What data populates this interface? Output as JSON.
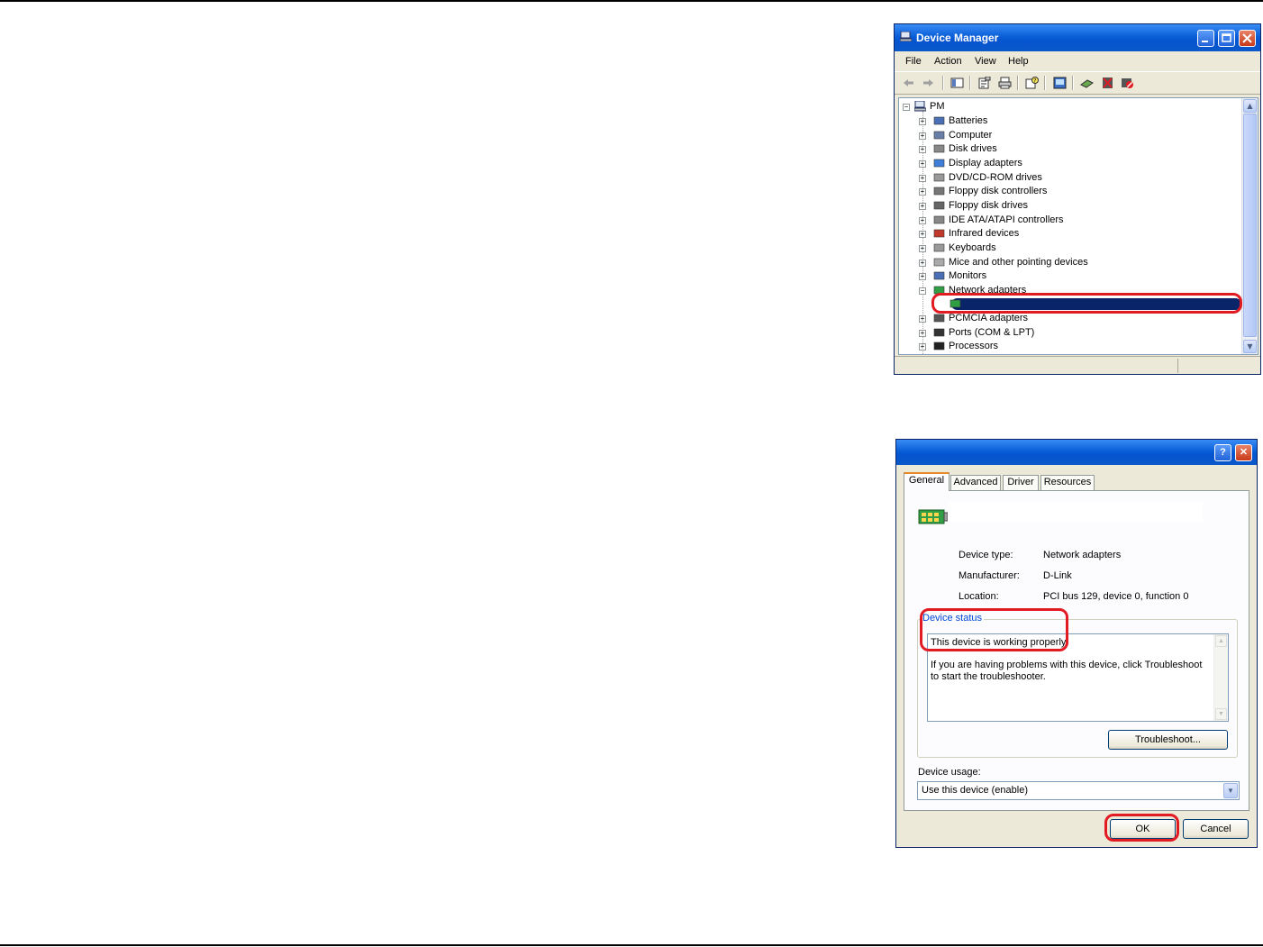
{
  "device_manager": {
    "title": "Device Manager",
    "menu": [
      "File",
      "Action",
      "View",
      "Help"
    ],
    "toolbar_icons": [
      "back-icon",
      "forward-icon",
      "show-hide-tree-icon",
      "properties-icon",
      "print-icon",
      "help-icon",
      "scan-hardware-icon",
      "update-driver-icon",
      "uninstall-icon",
      "disable-icon"
    ],
    "tree": {
      "root": "PM",
      "items": [
        {
          "label": "Batteries",
          "expander": "+"
        },
        {
          "label": "Computer",
          "expander": "+"
        },
        {
          "label": "Disk drives",
          "expander": "+"
        },
        {
          "label": "Display adapters",
          "expander": "+"
        },
        {
          "label": "DVD/CD-ROM drives",
          "expander": "+"
        },
        {
          "label": "Floppy disk controllers",
          "expander": "+"
        },
        {
          "label": "Floppy disk drives",
          "expander": "+"
        },
        {
          "label": "IDE ATA/ATAPI controllers",
          "expander": "+"
        },
        {
          "label": "Infrared devices",
          "expander": "+"
        },
        {
          "label": "Keyboards",
          "expander": "+"
        },
        {
          "label": "Mice and other pointing devices",
          "expander": "+"
        },
        {
          "label": "Monitors",
          "expander": "+"
        },
        {
          "label": "Network adapters",
          "expander": "−"
        },
        {
          "label": "",
          "expander": "",
          "selected": true
        },
        {
          "label": "PCMCIA adapters",
          "expander": "+"
        },
        {
          "label": "Ports (COM & LPT)",
          "expander": "+"
        },
        {
          "label": "Processors",
          "expander": "+"
        }
      ]
    }
  },
  "properties_dialog": {
    "help_glyph": "?",
    "close_glyph": "✕",
    "tabs": [
      "General",
      "Advanced",
      "Driver",
      "Resources"
    ],
    "active_tab": "General",
    "device_type_label": "Device type:",
    "device_type": "Network adapters",
    "manufacturer_label": "Manufacturer:",
    "manufacturer": "D-Link",
    "location_label": "Location:",
    "location": "PCI bus 129, device 0, function 0",
    "device_status_label": "Device status",
    "status_line": "This device is working properly.",
    "status_help": "If you are having problems with this device, click Troubleshoot to start the troubleshooter.",
    "troubleshoot_button": "Troubleshoot...",
    "device_usage_label": "Device usage:",
    "device_usage_value": "Use this device (enable)",
    "ok_button": "OK",
    "cancel_button": "Cancel"
  },
  "colors": {
    "highlight": "#e21b23",
    "title_blue": "#0554d0",
    "selection": "#0a246a"
  }
}
